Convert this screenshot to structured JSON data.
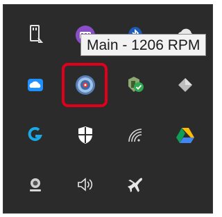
{
  "tray": {
    "tooltip_text": "Main - 1206 RPM",
    "highlight_color": "#e0001b",
    "background_color": "#2b2b2b",
    "icons": [
      {
        "row": 1,
        "col": 1,
        "icon": "usb-drive-icon"
      },
      {
        "row": 1,
        "col": 2,
        "icon": "memory-chip-app-icon"
      },
      {
        "row": 1,
        "col": 3,
        "icon": "bluetooth-icon"
      },
      {
        "row": 1,
        "col": 4,
        "icon": "cloud-sync-icon"
      },
      {
        "row": 2,
        "col": 1,
        "icon": "onedrive-icon"
      },
      {
        "row": 2,
        "col": 2,
        "icon": "fan-speed-monitor-icon",
        "highlighted": true
      },
      {
        "row": 2,
        "col": 3,
        "icon": "security-check-icon"
      },
      {
        "row": 2,
        "col": 4,
        "icon": "diamond-app-icon"
      },
      {
        "row": 3,
        "col": 1,
        "icon": "logitech-g-hub-icon"
      },
      {
        "row": 3,
        "col": 2,
        "icon": "windows-security-shield-icon"
      },
      {
        "row": 3,
        "col": 3,
        "icon": "wifi-icon"
      },
      {
        "row": 3,
        "col": 4,
        "icon": "google-drive-icon"
      },
      {
        "row": 4,
        "col": 1,
        "icon": "webcam-icon"
      },
      {
        "row": 4,
        "col": 2,
        "icon": "speaker-volume-icon"
      },
      {
        "row": 4,
        "col": 3,
        "icon": "airplane-mode-icon"
      }
    ]
  }
}
